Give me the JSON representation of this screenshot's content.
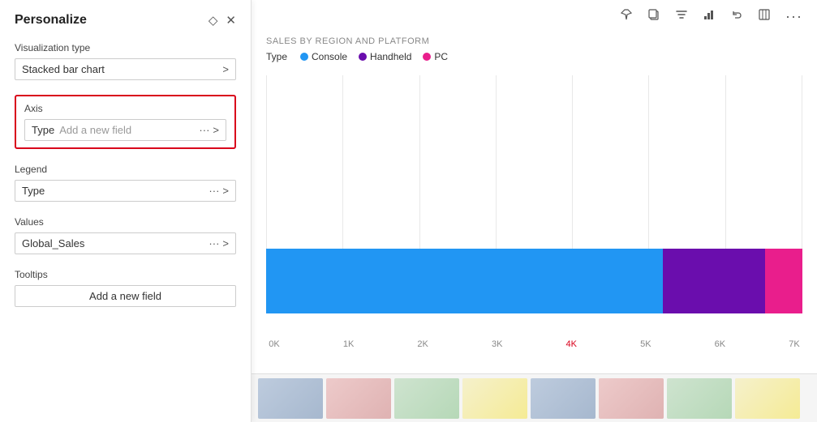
{
  "panel": {
    "title": "Personalize",
    "pin_icon": "◇",
    "close_icon": "✕",
    "viz_section": {
      "label": "Visualization type",
      "value": "Stacked bar chart",
      "arrow": ">"
    },
    "axis_section": {
      "label": "Axis",
      "type_text": "Type",
      "add_text": "Add a new field",
      "dots": "···",
      "arrow": ">"
    },
    "legend_section": {
      "label": "Legend",
      "value": "Type",
      "dots": "···",
      "arrow": ">"
    },
    "values_section": {
      "label": "Values",
      "value": "Global_Sales",
      "dots": "···",
      "arrow": ">"
    },
    "tooltips_section": {
      "label": "Tooltips",
      "add_text": "Add a new field"
    }
  },
  "chart": {
    "title": "SALES BY REGION AND PLATFORM",
    "legend": {
      "type_label": "Type",
      "items": [
        {
          "label": "Console",
          "color": "#2196F3"
        },
        {
          "label": "Handheld",
          "color": "#6A0DAD"
        },
        {
          "label": "PC",
          "color": "#E91E8C"
        }
      ]
    },
    "toolbar_icons": [
      "📌",
      "⧉",
      "⊽",
      "📊",
      "↩",
      "⊡",
      "···"
    ],
    "bar": {
      "segments": [
        {
          "label": "Console",
          "color": "#2196F3",
          "width_pct": 74
        },
        {
          "label": "Handheld",
          "color": "#6A0DAD",
          "width_pct": 19
        },
        {
          "label": "PC",
          "color": "#E91E8C",
          "width_pct": 7
        }
      ]
    },
    "x_axis_labels": [
      "0K",
      "1K",
      "2K",
      "3K",
      "4K",
      "5K",
      "6K",
      "7K"
    ]
  }
}
